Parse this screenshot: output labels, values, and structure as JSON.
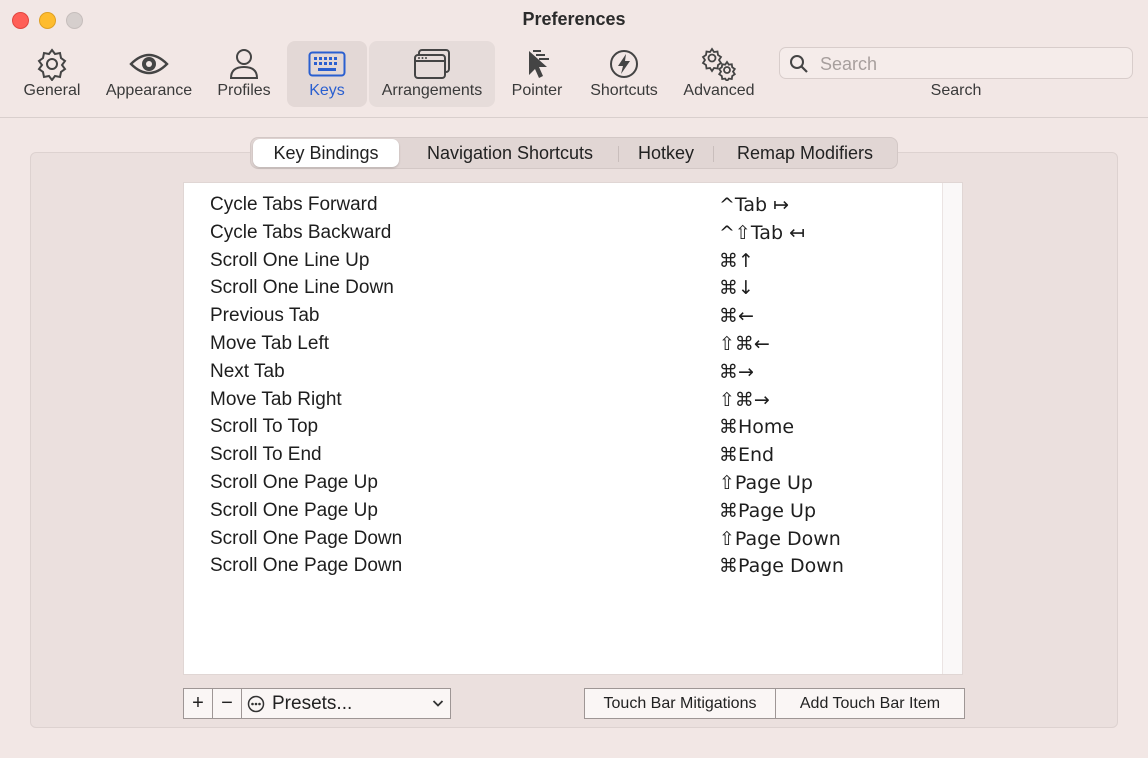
{
  "window": {
    "title": "Preferences",
    "accent_color": "#2a5fd0"
  },
  "toolbar": {
    "items": [
      {
        "label": "General",
        "icon": "gear-icon"
      },
      {
        "label": "Appearance",
        "icon": "eye-icon"
      },
      {
        "label": "Profiles",
        "icon": "person-icon"
      },
      {
        "label": "Keys",
        "icon": "keyboard-icon",
        "selected": true
      },
      {
        "label": "Arrangements",
        "icon": "window-icon"
      },
      {
        "label": "Pointer",
        "icon": "pointer-icon"
      },
      {
        "label": "Shortcuts",
        "icon": "lightning-icon"
      },
      {
        "label": "Advanced",
        "icon": "gears-icon"
      }
    ],
    "search": {
      "placeholder": "Search",
      "label": "Search"
    }
  },
  "tabs": [
    {
      "label": "Key Bindings",
      "active": true
    },
    {
      "label": "Navigation Shortcuts"
    },
    {
      "label": "Hotkey"
    },
    {
      "label": "Remap Modifiers"
    }
  ],
  "bindings": [
    {
      "action": "Cycle Tabs Forward",
      "shortcut": "^Tab ↦"
    },
    {
      "action": "Cycle Tabs Backward",
      "shortcut": "^⇧Tab ↤"
    },
    {
      "action": "Scroll One Line Up",
      "shortcut": "⌘↑"
    },
    {
      "action": "Scroll One Line Down",
      "shortcut": "⌘↓"
    },
    {
      "action": "Previous Tab",
      "shortcut": "⌘←"
    },
    {
      "action": "Move Tab Left",
      "shortcut": "⇧⌘←"
    },
    {
      "action": "Next Tab",
      "shortcut": "⌘→"
    },
    {
      "action": "Move Tab Right",
      "shortcut": "⇧⌘→"
    },
    {
      "action": "Scroll To Top",
      "shortcut": "⌘Home"
    },
    {
      "action": "Scroll To End",
      "shortcut": "⌘End"
    },
    {
      "action": "Scroll One Page Up",
      "shortcut": "⇧Page Up"
    },
    {
      "action": "Scroll One Page Up",
      "shortcut": "⌘Page Up"
    },
    {
      "action": "Scroll One Page Down",
      "shortcut": "⇧Page Down"
    },
    {
      "action": "Scroll One Page Down",
      "shortcut": "⌘Page Down"
    }
  ],
  "bottom": {
    "add_label": "+",
    "remove_label": "−",
    "presets_label": "Presets...",
    "touch_bar_mitigations": "Touch Bar Mitigations",
    "add_touch_bar_item": "Add Touch Bar Item"
  }
}
